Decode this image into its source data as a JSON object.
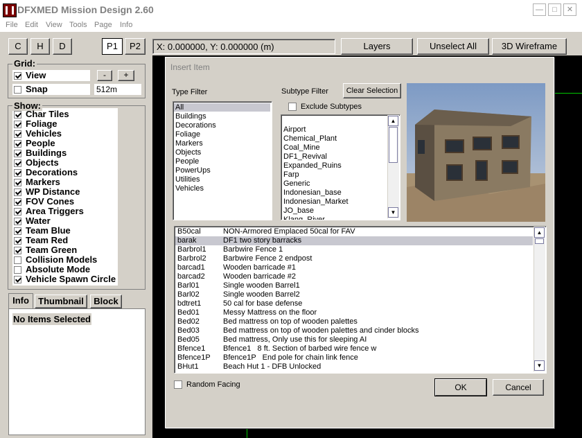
{
  "window": {
    "title": "DFXMED Mission Design 2.60"
  },
  "menu": [
    "File",
    "Edit",
    "View",
    "Tools",
    "Page",
    "Info"
  ],
  "toolbar": {
    "mode_buttons": [
      "C",
      "H",
      "D"
    ],
    "player_buttons": [
      "P1",
      "P2"
    ],
    "coords": "X: 0.000000, Y: 0.000000 (m)",
    "layers": "Layers",
    "unselect_all": "Unselect All",
    "wireframe": "3D Wireframe"
  },
  "grid": {
    "label": "Grid:",
    "view_label": "View",
    "view_checked": true,
    "minus": "-",
    "plus": "+",
    "snap_label": "Snap",
    "snap_checked": false,
    "snap_value": "512m"
  },
  "show": {
    "label": "Show:",
    "items": [
      {
        "label": "Char Tiles",
        "checked": true
      },
      {
        "label": "Foliage",
        "checked": true
      },
      {
        "label": "Vehicles",
        "checked": true
      },
      {
        "label": "People",
        "checked": true
      },
      {
        "label": "Buildings",
        "checked": true
      },
      {
        "label": "Objects",
        "checked": true
      },
      {
        "label": "Decorations",
        "checked": true
      },
      {
        "label": "Markers",
        "checked": true
      },
      {
        "label": "WP Distance",
        "checked": true
      },
      {
        "label": "FOV Cones",
        "checked": true
      },
      {
        "label": "Area Triggers",
        "checked": true
      },
      {
        "label": "Water",
        "checked": true
      },
      {
        "label": "Team Blue",
        "checked": true
      },
      {
        "label": "Team Red",
        "checked": true
      },
      {
        "label": "Team Green",
        "checked": true
      },
      {
        "label": "Collision Models",
        "checked": false
      },
      {
        "label": "Absolute Mode",
        "checked": false
      },
      {
        "label": "Vehicle Spawn Circle",
        "checked": true
      }
    ]
  },
  "info_tabs": [
    "Info",
    "Thumbnail",
    "Block"
  ],
  "info_text": "No Items Selected",
  "dialog": {
    "title": "Insert Item",
    "type_filter_label": "Type Filter",
    "type_filter": [
      "All",
      "Buildings",
      "Decorations",
      "Foliage",
      "Markers",
      "Objects",
      "People",
      "PowerUps",
      "Utilities",
      "Vehicles"
    ],
    "type_selected": 0,
    "subtype_label": "Subtype Filter",
    "clear_selection": "Clear Selection",
    "exclude_subtypes": "Exclude Subtypes",
    "subtypes": [
      "Airport",
      "Chemical_Plant",
      "Coal_Mine",
      "DF1_Revival",
      "Expanded_Ruins",
      "Farp",
      "Generic",
      "Indonesian_base",
      "Indonesian_Market",
      "JO_base",
      "Klang_River"
    ],
    "items": [
      {
        "code": "B50cal",
        "desc": "NON-Armored Emplaced 50cal for FAV"
      },
      {
        "code": "barak",
        "desc": "DF1 two story barracks"
      },
      {
        "code": "Barbrol1",
        "desc": "Barbwire Fence 1"
      },
      {
        "code": "Barbrol2",
        "desc": "Barbwire Fence 2 endpost"
      },
      {
        "code": "barcad1",
        "desc": "Wooden barricade #1"
      },
      {
        "code": "barcad2",
        "desc": "Wooden barricade #2"
      },
      {
        "code": "Barl01",
        "desc": "Single wooden Barrel1"
      },
      {
        "code": "Barl02",
        "desc": "Single wooden Barrel2"
      },
      {
        "code": "bdtret1",
        "desc": "50 cal for base defense"
      },
      {
        "code": "Bed01",
        "desc": "Messy Mattress on the floor"
      },
      {
        "code": "Bed02",
        "desc": "Bed mattress on top of wooden palettes"
      },
      {
        "code": "Bed03",
        "desc": "Bed mattress on top of wooden palettes and cinder blocks"
      },
      {
        "code": "Bed05",
        "desc": "Bed mattress, Only use this for sleeping AI"
      },
      {
        "code": "Bfence1",
        "desc": "Bfence1   8 ft. Section of barbed wire fence w"
      },
      {
        "code": "Bfence1P",
        "desc": "Bfence1P   End pole for chain link fence"
      },
      {
        "code": "BHut1",
        "desc": "Beach Hut 1 - DFB Unlocked"
      }
    ],
    "item_selected": 1,
    "random_facing": "Random Facing",
    "ok": "OK",
    "cancel": "Cancel"
  }
}
